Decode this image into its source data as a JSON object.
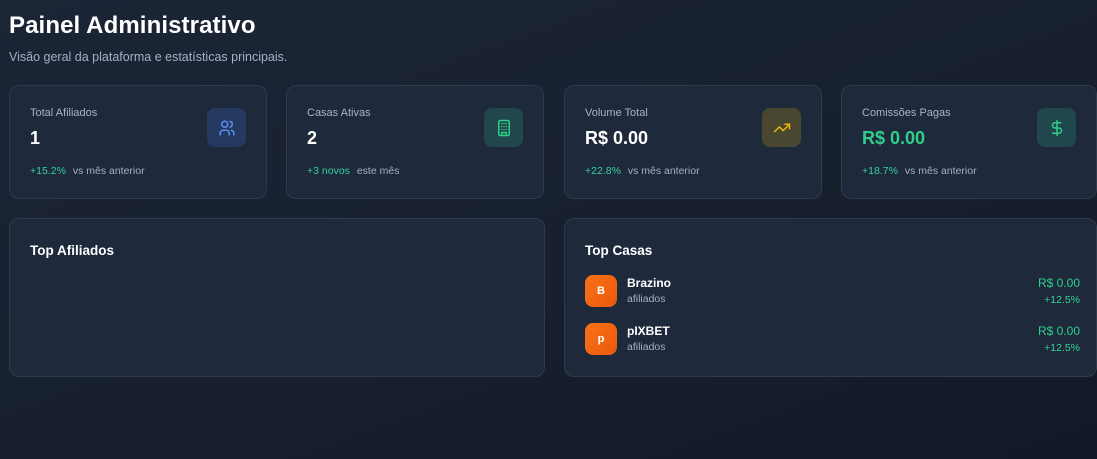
{
  "header": {
    "title": "Painel Administrativo",
    "subtitle": "Visão geral da plataforma e estatísticas principais."
  },
  "stats": [
    {
      "label": "Total Afiliados",
      "value": "1",
      "delta": "+15.2%",
      "note": "vs mês anterior",
      "icon": "users-icon",
      "accent": "#3b82f6"
    },
    {
      "label": "Casas Ativas",
      "value": "2",
      "delta": "+3 novos",
      "note": "este mês",
      "icon": "building-icon",
      "accent": "#22c58f"
    },
    {
      "label": "Volume Total",
      "value": "R$ 0.00",
      "delta": "+22.8%",
      "note": "vs mês anterior",
      "icon": "trending-up-icon",
      "accent": "#eab308"
    },
    {
      "label": "Comissões Pagas",
      "value": "R$ 0.00",
      "delta": "+18.7%",
      "note": "vs mês anterior",
      "icon": "dollar-icon",
      "accent": "#22c58f"
    }
  ],
  "top_affiliates": {
    "title": "Top Afiliados",
    "items": []
  },
  "top_houses": {
    "title": "Top Casas",
    "items": [
      {
        "initial": "B",
        "name": "Brazino",
        "subtitle": "afiliados",
        "amount": "R$ 0.00",
        "growth": "+12.5%"
      },
      {
        "initial": "p",
        "name": "pIXBET",
        "subtitle": "afiliados",
        "amount": "R$ 0.00",
        "growth": "+12.5%"
      }
    ]
  },
  "colors": {
    "background": "#1b2536",
    "card": "#1e293b",
    "positive": "#34d399",
    "house_avatar": "#f97316"
  }
}
